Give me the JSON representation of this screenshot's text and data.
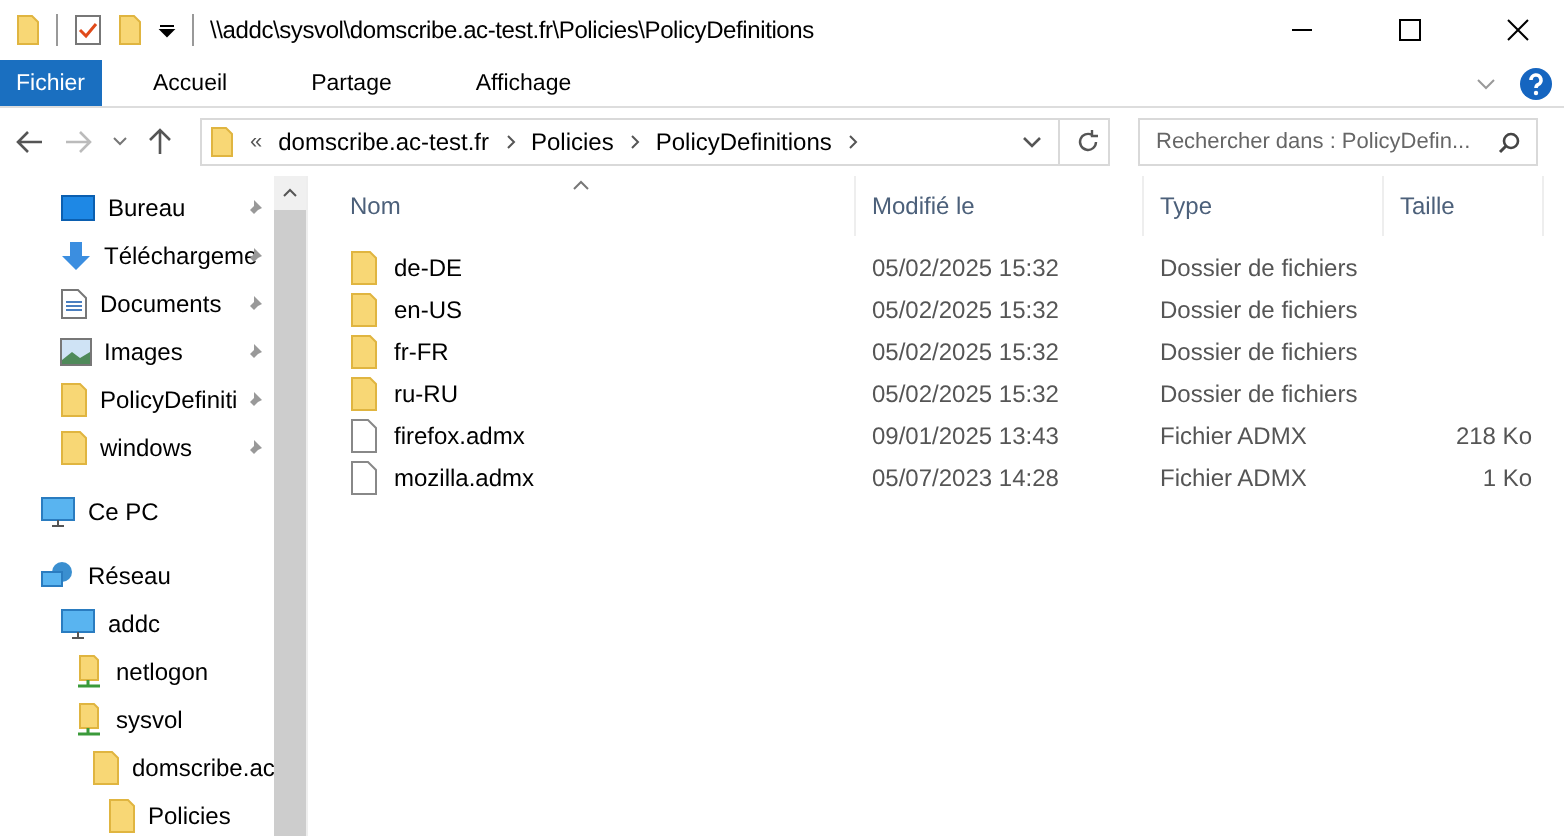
{
  "window": {
    "title": "\\\\addc\\sysvol\\domscribe.ac-test.fr\\Policies\\PolicyDefinitions"
  },
  "ribbon_tabs": [
    {
      "label": "Fichier",
      "selected": true
    },
    {
      "label": "Accueil",
      "selected": false
    },
    {
      "label": "Partage",
      "selected": false
    },
    {
      "label": "Affichage",
      "selected": false
    }
  ],
  "address_bar": {
    "overflow": "«",
    "segments": [
      "domscribe.ac-test.fr",
      "Policies",
      "PolicyDefinitions"
    ]
  },
  "search": {
    "placeholder": "Rechercher dans : PolicyDefin..."
  },
  "sidebar": {
    "quick_access": [
      {
        "label": "Bureau",
        "kind": "desktop",
        "pinned": true
      },
      {
        "label": "Téléchargeme",
        "kind": "download",
        "pinned": true
      },
      {
        "label": "Documents",
        "kind": "document",
        "pinned": true
      },
      {
        "label": "Images",
        "kind": "image",
        "pinned": true
      },
      {
        "label": "PolicyDefiniti",
        "kind": "folder",
        "pinned": true
      },
      {
        "label": "windows",
        "kind": "folder",
        "pinned": true
      }
    ],
    "tree": [
      {
        "label": "Ce PC",
        "kind": "computer"
      },
      {
        "label": "Réseau",
        "kind": "network",
        "children": [
          {
            "label": "addc",
            "kind": "computer",
            "children": [
              {
                "label": "netlogon",
                "kind": "share"
              },
              {
                "label": "sysvol",
                "kind": "share",
                "children": [
                  {
                    "label": "domscribe.ac",
                    "kind": "folder",
                    "children": [
                      {
                        "label": "Policies",
                        "kind": "folder"
                      }
                    ]
                  }
                ]
              }
            ]
          }
        ]
      }
    ]
  },
  "table": {
    "columns": [
      "Nom",
      "Modifié le",
      "Type",
      "Taille"
    ],
    "rows": [
      {
        "name": "de-DE",
        "modified": "05/02/2025 15:32",
        "type": "Dossier de fichiers",
        "kind": "folder"
      },
      {
        "name": "en-US",
        "modified": "05/02/2025 15:32",
        "type": "Dossier de fichiers",
        "kind": "folder"
      },
      {
        "name": "fr-FR",
        "modified": "05/02/2025 15:32",
        "type": "Dossier de fichiers",
        "kind": "folder"
      },
      {
        "name": "ru-RU",
        "modified": "05/02/2025 15:32",
        "type": "Dossier de fichiers",
        "kind": "folder"
      },
      {
        "name": "firefox.admx",
        "modified": "09/01/2025 13:43",
        "type": "Fichier ADMX",
        "size": "218 Ko",
        "kind": "file"
      },
      {
        "name": "mozilla.admx",
        "modified": "05/07/2023 14:28",
        "type": "Fichier ADMX",
        "size": "1 Ko",
        "kind": "file"
      }
    ]
  }
}
